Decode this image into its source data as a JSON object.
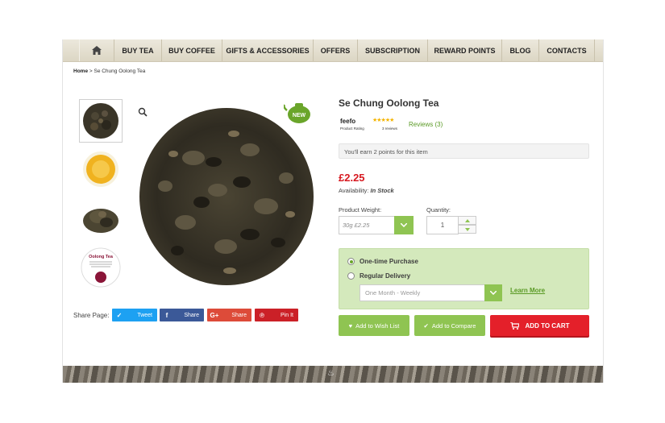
{
  "nav": {
    "items": [
      "BUY TEA",
      "BUY COFFEE",
      "GIFTS & ACCESSORIES",
      "OFFERS",
      "SUBSCRIPTION",
      "REWARD POINTS",
      "BLOG",
      "CONTACTS"
    ]
  },
  "breadcrumb": {
    "home": "Home",
    "separator": ">",
    "current": "Se Chung Oolong Tea"
  },
  "product": {
    "title": "Se Chung Oolong Tea",
    "new_badge": "NEW",
    "feefo": {
      "brand": "feefo",
      "rating_label": "Product Rating",
      "review_count_text": "3 reviews",
      "stars": 4.5
    },
    "reviews_link": "Reviews (3)",
    "points_text": "You'll earn 2 points for this item",
    "price": "£2.25",
    "availability_label": "Availability:",
    "availability_value": "In Stock",
    "weight_label": "Product Weight:",
    "weight_value": "30g £2.25",
    "quantity_label": "Quantity:",
    "quantity_value": "1",
    "thumb_label": {
      "title": "Oolong Tea",
      "text": "Infuse for 2 to 5 minutes with a water temperature between 80 and 90 degrees",
      "badge": "Fresh Water"
    }
  },
  "delivery": {
    "one_time": "One-time Purchase",
    "regular": "Regular Delivery",
    "frequency": "One Month - Weekly",
    "learn_more": "Learn More"
  },
  "actions": {
    "wishlist": "Add to Wish List",
    "compare": "Add to Compare",
    "cart": "ADD TO CART"
  },
  "share": {
    "label": "Share Page:",
    "buttons": [
      {
        "icon": "twitter-icon",
        "label": "Tweet",
        "color": "#1da1f2"
      },
      {
        "icon": "facebook-icon",
        "label": "Share",
        "color": "#3b5998"
      },
      {
        "icon": "google-plus-icon",
        "label": "Share",
        "color": "#dd4b39"
      },
      {
        "icon": "pinterest-icon",
        "label": "Pin It",
        "color": "#cb2027"
      }
    ]
  },
  "colors": {
    "accent_green": "#8fc452",
    "price_red": "#d71920",
    "cart_red": "#e4202a",
    "delivery_bg": "#d4e9bc"
  }
}
